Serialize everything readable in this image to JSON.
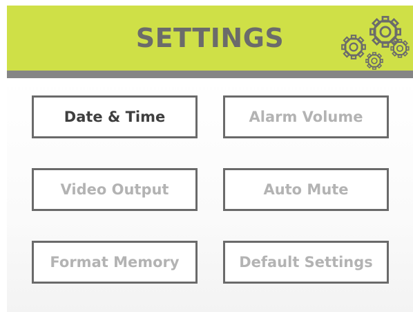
{
  "header": {
    "title": "SETTINGS",
    "icon": "gears-icon"
  },
  "colors": {
    "header_background": "#cfe047",
    "header_rule": "#858585",
    "button_border": "#6a6a6a",
    "active_text": "#3f3f3f",
    "inactive_text": "#b3b3b3"
  },
  "menu": {
    "items": [
      {
        "label": "Date & Time",
        "active": true
      },
      {
        "label": "Alarm Volume",
        "active": false
      },
      {
        "label": "Video Output",
        "active": false
      },
      {
        "label": "Auto Mute",
        "active": false
      },
      {
        "label": "Format Memory",
        "active": false
      },
      {
        "label": "Default Settings",
        "active": false
      }
    ]
  }
}
